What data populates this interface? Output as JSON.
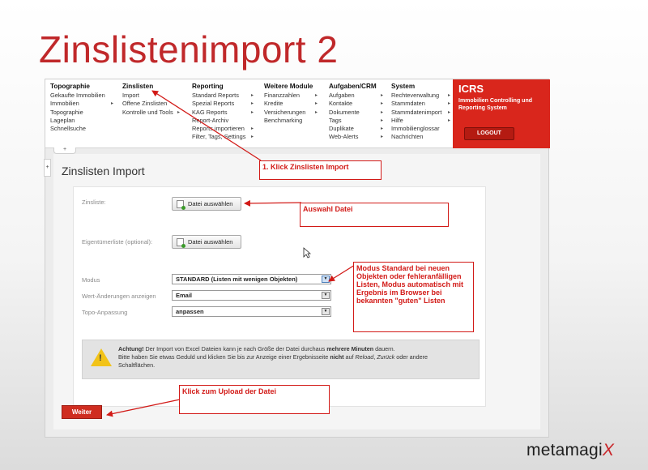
{
  "slide": {
    "title": "Zinslistenimport 2"
  },
  "menu": {
    "columns": [
      {
        "header": "Topographie",
        "items": [
          "Gekaufte Immobilien",
          "Immobilien",
          "Topographie",
          "Lageplan",
          "Schnellsuche"
        ]
      },
      {
        "header": "Zinslisten",
        "items": [
          "Import",
          "Offene Zinslisten",
          "Kontrolle und Tools"
        ]
      },
      {
        "header": "Reporting",
        "items": [
          "Standard Reports",
          "Spezial Reports",
          "KAG Reports",
          "Report-Archiv",
          "Reports importieren",
          "Filter, Tags, Settings"
        ]
      },
      {
        "header": "Weitere Module",
        "items": [
          "Finanzzahlen",
          "Kredite",
          "Versicherungen",
          "Benchmarking"
        ]
      },
      {
        "header": "Aufgaben/CRM",
        "items": [
          "Aufgaben",
          "Kontakte",
          "Dokumente",
          "Tags",
          "Duplikate",
          "Web-Alerts"
        ]
      },
      {
        "header": "System",
        "items": [
          "Rechteverwaltung",
          "Stammdaten",
          "Stammdatenimport",
          "Hilfe",
          "Immobilienglossar",
          "Nachrichten"
        ]
      }
    ],
    "arrow_glyph": "▸"
  },
  "brand": {
    "name": "ICRS",
    "subtitle": "Immobilien Controlling und Reporting System",
    "logout_label": "LOGOUT"
  },
  "page": {
    "heading": "Zinslisten Import",
    "tab_glyph": "+",
    "side_toggle_glyph": "+"
  },
  "form": {
    "zinsliste_label": "Zinsliste:",
    "file_button_label": "Datei auswählen",
    "eigentuemer_label": "Eigentümerliste (optional):",
    "file_button2_label": "Datei auswählen",
    "modus_label": "Modus",
    "modus_value": "STANDARD (Listen mit wenigen Objekten)",
    "wert_label": "Wert-Änderungen anzeigen",
    "wert_value": "Email",
    "topo_label": "Topo-Anpassung",
    "topo_value": "anpassen",
    "dropdown_glyph": "▼"
  },
  "warning": {
    "glyph": "!",
    "l1_strong": "Achtung!",
    "l1_text": " Der Import von Excel Dateien kann je nach Größe der Datei durchaus ",
    "l1_strong2": "mehrere Minuten",
    "l1_end": " dauern.",
    "l2_text": "Bitte haben Sie etwas Geduld und klicken Sie bis zur Anzeige einer Ergebnisseite ",
    "l2_strong": "nicht",
    "l2_text2": " auf ",
    "l2_em1": "Reload",
    "l2_sep": ", ",
    "l2_em2": "Zurück",
    "l2_end": " oder andere",
    "l3_text": "Schaltflächen."
  },
  "submit_label": "Weiter",
  "callouts": {
    "c1": "1. Klick Zinslisten Import",
    "c2": "Auswahl Datei",
    "c3": "Modus Standard bei neuen Objekten oder fehleranfälligen Listen, Modus automatisch mit Ergebnis im Browser bei bekannten \"guten\" Listen",
    "c4": "Klick zum Upload der Datei"
  },
  "logo": {
    "text": "metamagi",
    "x": "X"
  },
  "colors": {
    "accent_red": "#d9261c",
    "title_red": "#c0282a",
    "callout_red": "#d21a17",
    "warning_yellow": "#f2c318"
  }
}
